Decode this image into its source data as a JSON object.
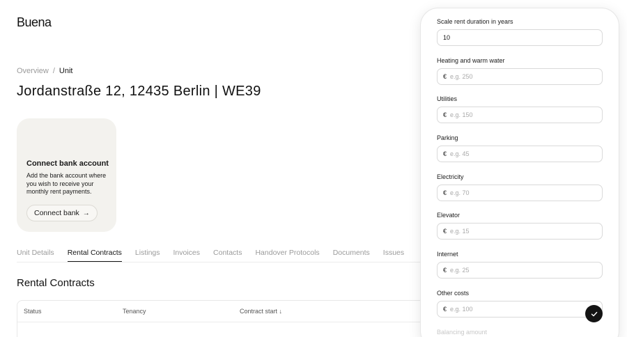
{
  "app": {
    "logo": "Buena"
  },
  "breadcrumb": {
    "parent": "Overview",
    "separator": "/",
    "current": "Unit"
  },
  "page_title": "Jordanstraße 12, 12435 Berlin | WE39",
  "bank_card": {
    "title": "Connect bank account",
    "description": "Add the bank account where you wish to receive your monthly rent payments.",
    "button_label": "Connect bank",
    "button_icon": "arrow-right-icon"
  },
  "tabs": [
    {
      "label": "Unit Details",
      "active": false
    },
    {
      "label": "Rental Contracts",
      "active": true
    },
    {
      "label": "Listings",
      "active": false
    },
    {
      "label": "Invoices",
      "active": false
    },
    {
      "label": "Contacts",
      "active": false
    },
    {
      "label": "Handover Protocols",
      "active": false
    },
    {
      "label": "Documents",
      "active": false
    },
    {
      "label": "Issues",
      "active": false
    }
  ],
  "section": {
    "title": "Rental Contracts"
  },
  "table": {
    "columns": [
      "Status",
      "Tenancy",
      "Contract start ↓"
    ]
  },
  "panel": {
    "currency_symbol": "€",
    "fields": [
      {
        "label": "Scale rent duration in years",
        "value": "10",
        "placeholder": ""
      },
      {
        "label": "Heating and warm water",
        "value": "",
        "placeholder": "e.g. 250"
      },
      {
        "label": "Utilities",
        "value": "",
        "placeholder": "e.g. 150"
      },
      {
        "label": "Parking",
        "value": "",
        "placeholder": "e.g. 45"
      },
      {
        "label": "Electricity",
        "value": "",
        "placeholder": "e.g. 70"
      },
      {
        "label": "Elevator",
        "value": "",
        "placeholder": "e.g. 15"
      },
      {
        "label": "Internet",
        "value": "",
        "placeholder": "e.g. 25"
      },
      {
        "label": "Other costs",
        "value": "",
        "placeholder": "e.g. 100"
      }
    ],
    "next_label": "Balancing amount"
  },
  "confirm_icon": "check-icon"
}
